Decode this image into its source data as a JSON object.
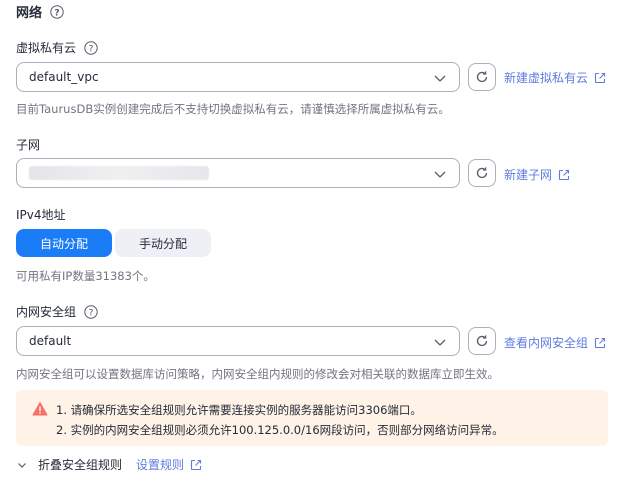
{
  "network": {
    "title": "网络"
  },
  "vpc": {
    "label": "虚拟私有云",
    "value": "default_vpc",
    "create_link": "新建虚拟私有云",
    "hint": "目前TaurusDB实例创建完成后不支持切换虚拟私有云，请谨慎选择所属虚拟私有云。"
  },
  "subnet": {
    "label": "子网",
    "create_link": "新建子网"
  },
  "ipv4": {
    "label": "IPv4地址",
    "auto_label": "自动分配",
    "manual_label": "手动分配",
    "hint": "可用私有IP数量31383个。"
  },
  "security_group": {
    "label": "内网安全组",
    "value": "default",
    "view_link": "查看内网安全组",
    "hint": "内网安全组可以设置数据库访问策略，内网安全组内规则的修改会对相关联的数据库立即生效。",
    "warnings": [
      "1. 请确保所选安全组规则允许需要连接实例的服务器能访问3306端口。",
      "2. 实例的内网安全组规则必须允许100.125.0.0/16网段访问，否则部分网络访问异常。"
    ],
    "collapse_label": "折叠安全组规则",
    "settings_link": "设置规则"
  },
  "colors": {
    "primary": "#1b7cf7",
    "link": "#5e7ce0",
    "warning_bg": "#fff2e6",
    "warning_icon": "#f66f6a"
  },
  "icons": [
    "help-icon",
    "chevron-down-icon",
    "refresh-icon",
    "external-link-icon",
    "warning-icon"
  ]
}
